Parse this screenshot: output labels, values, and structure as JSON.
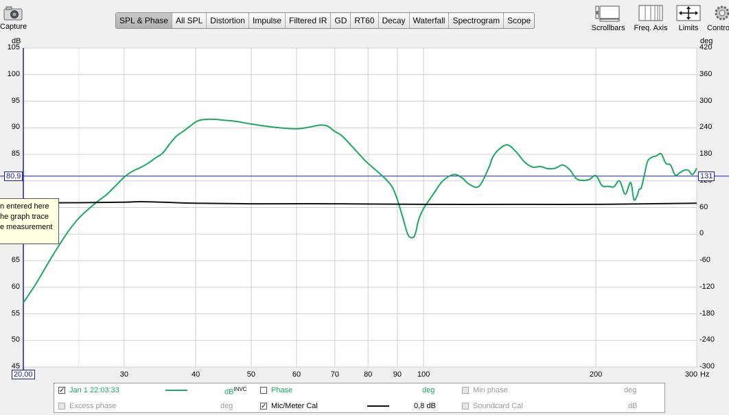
{
  "toolbar": {
    "capture_label": "Capture",
    "tabs": [
      "SPL & Phase",
      "All SPL",
      "Distortion",
      "Impulse",
      "Filtered IR",
      "GD",
      "RT60",
      "Decay",
      "Waterfall",
      "Spectrogram",
      "Scope"
    ],
    "active_tab": 0,
    "scrollbars_label": "Scrollbars",
    "freq_axis_label": "Freq. Axis",
    "limits_label": "Limits",
    "controls_label": "Contro"
  },
  "colors": {
    "spl": "#18a860",
    "cal": "#111111",
    "marker": "#1a1aa8",
    "grid": "#d0d0d0"
  },
  "tooltip": {
    "lines": [
      "n entered here",
      "he graph trace",
      "e measurement"
    ]
  },
  "cursor": {
    "y_left_value": "80,9",
    "y_right_value": "131",
    "x_value": "20,00"
  },
  "legend": {
    "items": [
      {
        "label": "Jan 1 22:03:33",
        "checked": true,
        "unit": "dB",
        "unit_sup": "INVC"
      },
      {
        "label": "Phase",
        "checked": false,
        "unit": "deg"
      },
      {
        "label": "Min phase",
        "checked": false,
        "unit": "deg"
      },
      {
        "label": "Excess phase",
        "checked": false,
        "unit": "deg"
      },
      {
        "label": "Mic/Meter Cal",
        "checked": true,
        "unit": "0,8 dB"
      },
      {
        "label": "Soundcard Cal",
        "checked": false,
        "unit": "dB"
      }
    ]
  },
  "chart_data": {
    "type": "line",
    "ylabel": "dB",
    "y2label": "deg",
    "xunit": "Hz",
    "x_scale": "log",
    "xlim": [
      20,
      300
    ],
    "ylim": [
      45,
      105
    ],
    "y2lim": [
      -300,
      420
    ],
    "x_ticks": [
      "30",
      "40",
      "50",
      "60",
      "70",
      "80",
      "90",
      "100",
      "200",
      "300"
    ],
    "x_tick_values": [
      30,
      40,
      50,
      60,
      70,
      80,
      90,
      100,
      200,
      300
    ],
    "y_ticks": [
      "45",
      "50",
      "55",
      "60",
      "65",
      "70",
      "75",
      "80",
      "85",
      "90",
      "95",
      "100",
      "105"
    ],
    "y_tick_values": [
      45,
      50,
      55,
      60,
      65,
      70,
      75,
      80,
      85,
      90,
      95,
      100,
      105
    ],
    "y2_ticks": [
      "-300",
      "-240",
      "-180",
      "-120",
      "-60",
      "0",
      "60",
      "120",
      "180",
      "240",
      "300",
      "360",
      "420"
    ],
    "y2_tick_values": [
      -300,
      -240,
      -180,
      -120,
      -60,
      0,
      60,
      120,
      180,
      240,
      300,
      360,
      420
    ],
    "grid": true,
    "cursor_y": 80.9,
    "series": [
      {
        "name": "Jan 1 22:03:33",
        "color": "#18a860",
        "x": [
          20,
          21,
          22,
          23,
          24,
          25,
          26,
          27,
          28,
          29,
          30,
          31,
          32,
          33,
          34,
          35,
          36,
          37,
          38,
          39,
          40,
          41,
          42,
          43,
          44,
          45,
          47,
          50,
          53,
          56,
          60,
          63,
          66,
          68,
          70,
          72,
          75,
          78,
          80,
          85,
          88,
          90,
          92,
          94,
          96,
          97,
          98,
          100,
          104,
          108,
          113,
          117,
          120,
          125,
          130,
          132,
          135,
          140,
          145,
          150,
          155,
          160,
          165,
          170,
          175,
          180,
          185,
          190,
          195,
          200,
          205,
          210,
          215,
          220,
          225,
          230,
          233,
          236,
          238,
          240,
          243,
          246,
          250,
          255,
          260,
          265,
          270,
          275,
          280,
          285,
          290,
          295,
          300
        ],
        "y": [
          57.1,
          60.5,
          64.2,
          67.6,
          70.6,
          73.0,
          74.7,
          76.2,
          77.5,
          79.1,
          80.7,
          81.8,
          82.5,
          83.3,
          84.3,
          85.2,
          86.9,
          88.4,
          89.3,
          90.2,
          91.1,
          91.5,
          91.6,
          91.6,
          91.5,
          91.4,
          91.2,
          90.7,
          90.3,
          90.0,
          89.8,
          90.1,
          90.5,
          90.3,
          89.3,
          88.5,
          86.5,
          84.5,
          83.3,
          80.8,
          79.0,
          76.5,
          73.1,
          69.8,
          69.4,
          70.5,
          72.6,
          74.8,
          77.5,
          80.0,
          81.2,
          80.5,
          79.4,
          79.0,
          82.5,
          84.4,
          85.8,
          86.8,
          85.5,
          83.6,
          82.6,
          82.7,
          82.3,
          82.4,
          83.0,
          82.1,
          80.4,
          80.1,
          80.3,
          81.0,
          79.1,
          79.0,
          78.9,
          80.0,
          77.5,
          79.7,
          76.5,
          77.2,
          78.4,
          78.7,
          81.1,
          83.6,
          84.4,
          84.7,
          85.1,
          83.3,
          83.0,
          81.1,
          81.5,
          82.0,
          82.0,
          81.2,
          82.4
        ]
      },
      {
        "name": "Mic/Meter Cal",
        "color": "#111111",
        "x": [
          20,
          25,
          30,
          32,
          35,
          40,
          50,
          70,
          100,
          150,
          200,
          300
        ],
        "y": [
          75.9,
          75.9,
          76.0,
          76.1,
          76.0,
          75.8,
          75.7,
          75.7,
          75.6,
          75.6,
          75.6,
          75.8
        ]
      }
    ]
  }
}
